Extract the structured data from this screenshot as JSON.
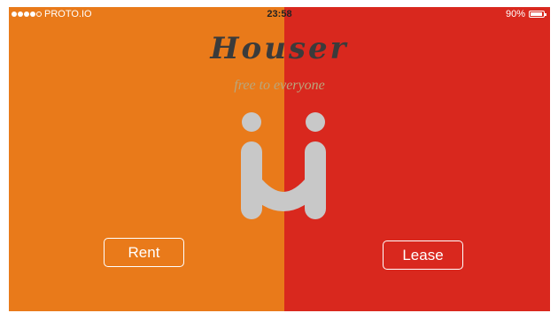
{
  "colors": {
    "rent_panel": "#E97A1A",
    "lease_panel": "#D9281E",
    "logo": "#C8C8C8"
  },
  "status_bar": {
    "carrier": "PROTO.IO",
    "time": "23:58",
    "battery": "90%",
    "battery_level": 0.9
  },
  "app": {
    "title": "Houser",
    "tagline": "free to everyone",
    "logo_icon": "houser-logo-icon"
  },
  "actions": {
    "rent_label": "Rent",
    "lease_label": "Lease"
  }
}
